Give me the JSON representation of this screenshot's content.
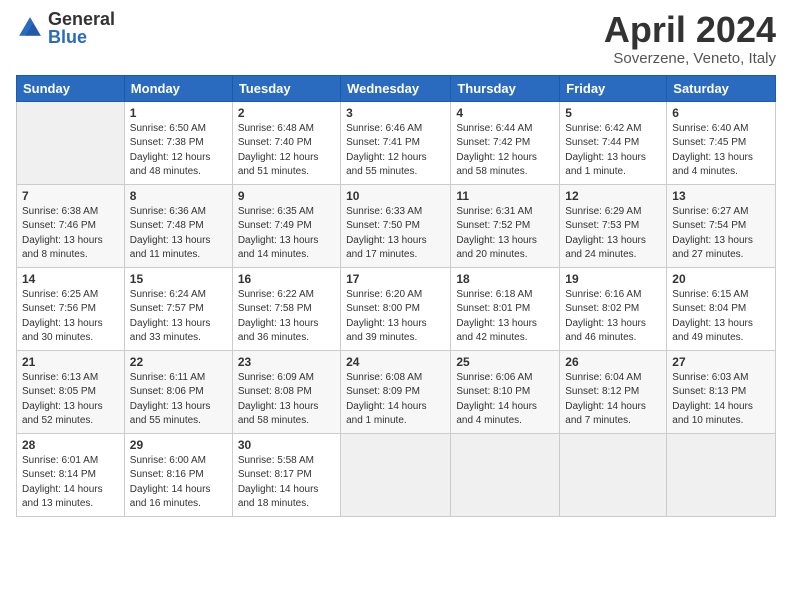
{
  "header": {
    "logo_general": "General",
    "logo_blue": "Blue",
    "title": "April 2024",
    "location": "Soverzene, Veneto, Italy"
  },
  "days_of_week": [
    "Sunday",
    "Monday",
    "Tuesday",
    "Wednesday",
    "Thursday",
    "Friday",
    "Saturday"
  ],
  "weeks": [
    [
      {
        "day": "",
        "info": ""
      },
      {
        "day": "1",
        "info": "Sunrise: 6:50 AM\nSunset: 7:38 PM\nDaylight: 12 hours\nand 48 minutes."
      },
      {
        "day": "2",
        "info": "Sunrise: 6:48 AM\nSunset: 7:40 PM\nDaylight: 12 hours\nand 51 minutes."
      },
      {
        "day": "3",
        "info": "Sunrise: 6:46 AM\nSunset: 7:41 PM\nDaylight: 12 hours\nand 55 minutes."
      },
      {
        "day": "4",
        "info": "Sunrise: 6:44 AM\nSunset: 7:42 PM\nDaylight: 12 hours\nand 58 minutes."
      },
      {
        "day": "5",
        "info": "Sunrise: 6:42 AM\nSunset: 7:44 PM\nDaylight: 13 hours\nand 1 minute."
      },
      {
        "day": "6",
        "info": "Sunrise: 6:40 AM\nSunset: 7:45 PM\nDaylight: 13 hours\nand 4 minutes."
      }
    ],
    [
      {
        "day": "7",
        "info": "Sunrise: 6:38 AM\nSunset: 7:46 PM\nDaylight: 13 hours\nand 8 minutes."
      },
      {
        "day": "8",
        "info": "Sunrise: 6:36 AM\nSunset: 7:48 PM\nDaylight: 13 hours\nand 11 minutes."
      },
      {
        "day": "9",
        "info": "Sunrise: 6:35 AM\nSunset: 7:49 PM\nDaylight: 13 hours\nand 14 minutes."
      },
      {
        "day": "10",
        "info": "Sunrise: 6:33 AM\nSunset: 7:50 PM\nDaylight: 13 hours\nand 17 minutes."
      },
      {
        "day": "11",
        "info": "Sunrise: 6:31 AM\nSunset: 7:52 PM\nDaylight: 13 hours\nand 20 minutes."
      },
      {
        "day": "12",
        "info": "Sunrise: 6:29 AM\nSunset: 7:53 PM\nDaylight: 13 hours\nand 24 minutes."
      },
      {
        "day": "13",
        "info": "Sunrise: 6:27 AM\nSunset: 7:54 PM\nDaylight: 13 hours\nand 27 minutes."
      }
    ],
    [
      {
        "day": "14",
        "info": "Sunrise: 6:25 AM\nSunset: 7:56 PM\nDaylight: 13 hours\nand 30 minutes."
      },
      {
        "day": "15",
        "info": "Sunrise: 6:24 AM\nSunset: 7:57 PM\nDaylight: 13 hours\nand 33 minutes."
      },
      {
        "day": "16",
        "info": "Sunrise: 6:22 AM\nSunset: 7:58 PM\nDaylight: 13 hours\nand 36 minutes."
      },
      {
        "day": "17",
        "info": "Sunrise: 6:20 AM\nSunset: 8:00 PM\nDaylight: 13 hours\nand 39 minutes."
      },
      {
        "day": "18",
        "info": "Sunrise: 6:18 AM\nSunset: 8:01 PM\nDaylight: 13 hours\nand 42 minutes."
      },
      {
        "day": "19",
        "info": "Sunrise: 6:16 AM\nSunset: 8:02 PM\nDaylight: 13 hours\nand 46 minutes."
      },
      {
        "day": "20",
        "info": "Sunrise: 6:15 AM\nSunset: 8:04 PM\nDaylight: 13 hours\nand 49 minutes."
      }
    ],
    [
      {
        "day": "21",
        "info": "Sunrise: 6:13 AM\nSunset: 8:05 PM\nDaylight: 13 hours\nand 52 minutes."
      },
      {
        "day": "22",
        "info": "Sunrise: 6:11 AM\nSunset: 8:06 PM\nDaylight: 13 hours\nand 55 minutes."
      },
      {
        "day": "23",
        "info": "Sunrise: 6:09 AM\nSunset: 8:08 PM\nDaylight: 13 hours\nand 58 minutes."
      },
      {
        "day": "24",
        "info": "Sunrise: 6:08 AM\nSunset: 8:09 PM\nDaylight: 14 hours\nand 1 minute."
      },
      {
        "day": "25",
        "info": "Sunrise: 6:06 AM\nSunset: 8:10 PM\nDaylight: 14 hours\nand 4 minutes."
      },
      {
        "day": "26",
        "info": "Sunrise: 6:04 AM\nSunset: 8:12 PM\nDaylight: 14 hours\nand 7 minutes."
      },
      {
        "day": "27",
        "info": "Sunrise: 6:03 AM\nSunset: 8:13 PM\nDaylight: 14 hours\nand 10 minutes."
      }
    ],
    [
      {
        "day": "28",
        "info": "Sunrise: 6:01 AM\nSunset: 8:14 PM\nDaylight: 14 hours\nand 13 minutes."
      },
      {
        "day": "29",
        "info": "Sunrise: 6:00 AM\nSunset: 8:16 PM\nDaylight: 14 hours\nand 16 minutes."
      },
      {
        "day": "30",
        "info": "Sunrise: 5:58 AM\nSunset: 8:17 PM\nDaylight: 14 hours\nand 18 minutes."
      },
      {
        "day": "",
        "info": ""
      },
      {
        "day": "",
        "info": ""
      },
      {
        "day": "",
        "info": ""
      },
      {
        "day": "",
        "info": ""
      }
    ]
  ]
}
